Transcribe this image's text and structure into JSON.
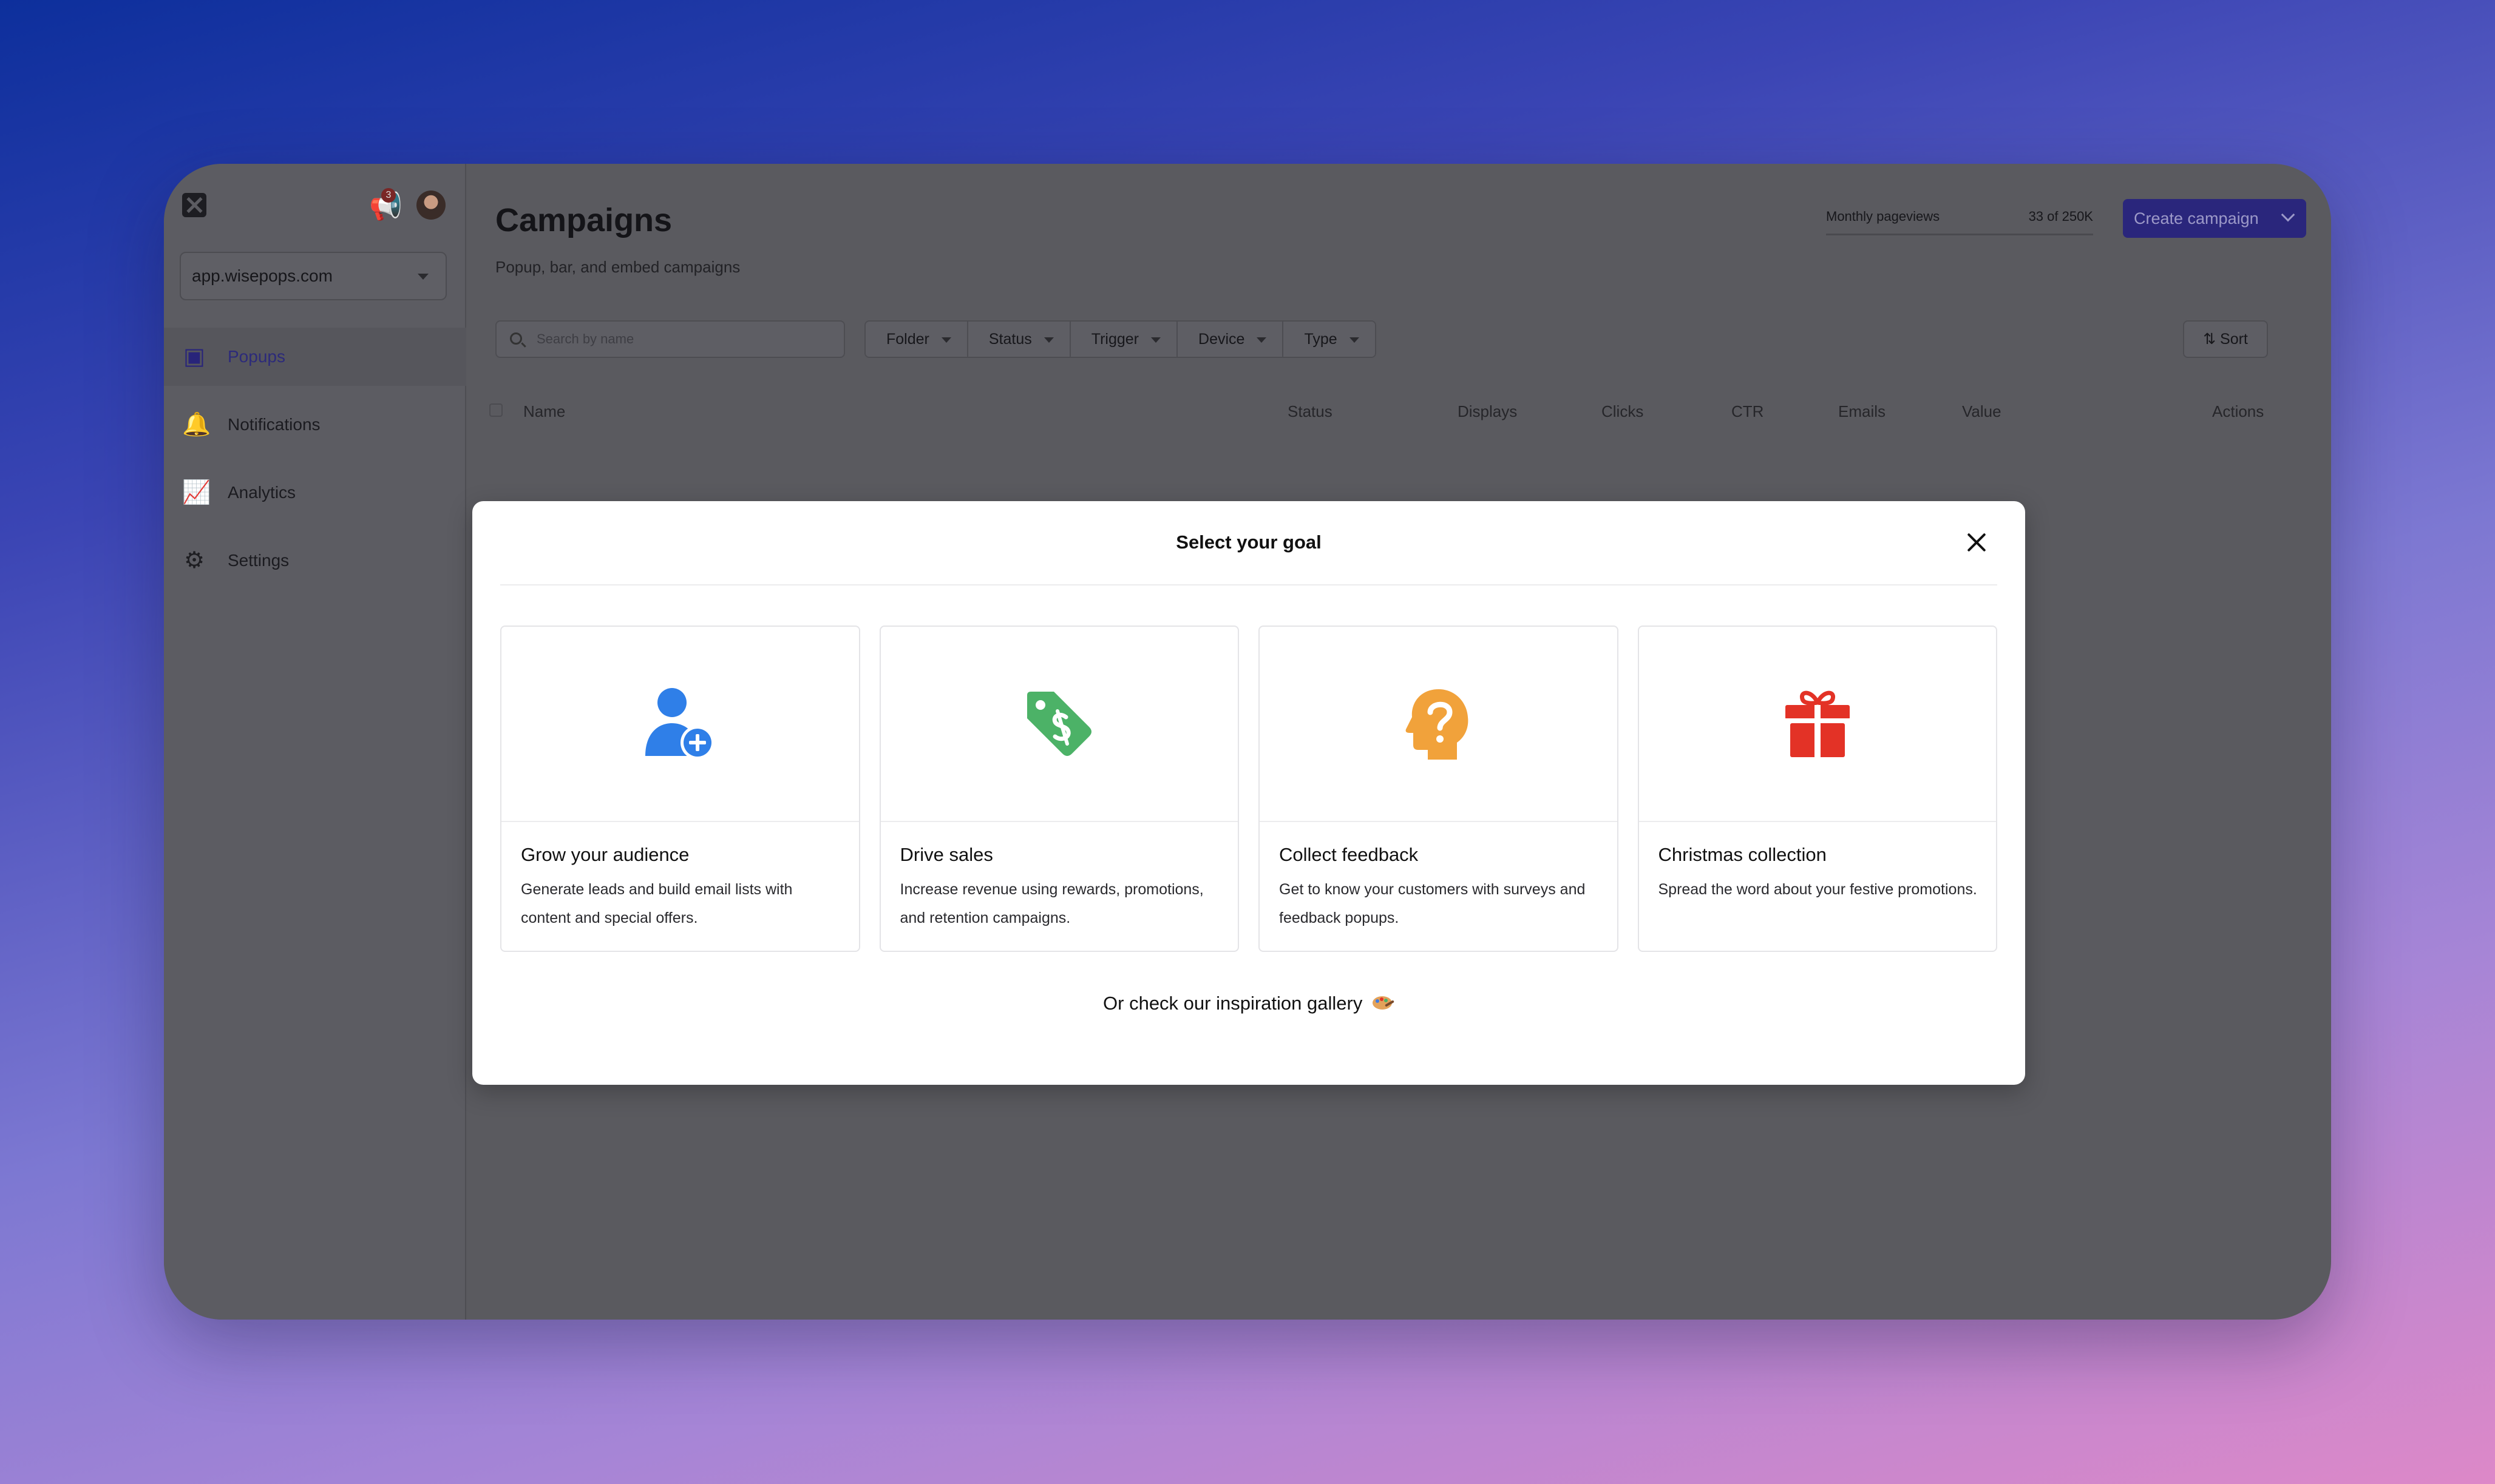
{
  "sidebar": {
    "notification_count": "3",
    "site_select": "app.wisepops.com",
    "items": [
      {
        "label": "Popups",
        "icon": "popup-window-icon"
      },
      {
        "label": "Notifications",
        "icon": "bell-icon"
      },
      {
        "label": "Analytics",
        "icon": "chart-icon"
      },
      {
        "label": "Settings",
        "icon": "gear-icon"
      }
    ]
  },
  "header": {
    "title": "Campaigns",
    "subtitle": "Popup, bar, and embed campaigns",
    "pageviews_label": "Monthly pageviews",
    "pageviews_value": "33 of 250K",
    "create_label": "Create campaign"
  },
  "toolbar": {
    "search_placeholder": "Search by name",
    "filters": [
      "Folder",
      "Status",
      "Trigger",
      "Device",
      "Type"
    ],
    "sort_label": "Sort"
  },
  "table": {
    "columns": [
      "Name",
      "Status",
      "Displays",
      "Clicks",
      "CTR",
      "Emails",
      "Value",
      "Actions"
    ]
  },
  "modal": {
    "title": "Select your goal",
    "cards": [
      {
        "title": "Grow your audience",
        "description": "Generate leads and build email lists with content and special offers.",
        "icon": "add-user-icon",
        "color": "#2f7fe8"
      },
      {
        "title": "Drive sales",
        "description": "Increase revenue using rewards, promotions, and retention campaigns.",
        "icon": "price-tag-icon",
        "color": "#4cb267"
      },
      {
        "title": "Collect feedback",
        "description": "Get to know your customers with surveys and feedback popups.",
        "icon": "question-head-icon",
        "color": "#f1a23b"
      },
      {
        "title": "Christmas collection",
        "description": "Spread the word about your festive promotions.",
        "icon": "gift-icon",
        "color": "#e33226"
      }
    ],
    "gallery_link": "Or check our inspiration gallery"
  }
}
